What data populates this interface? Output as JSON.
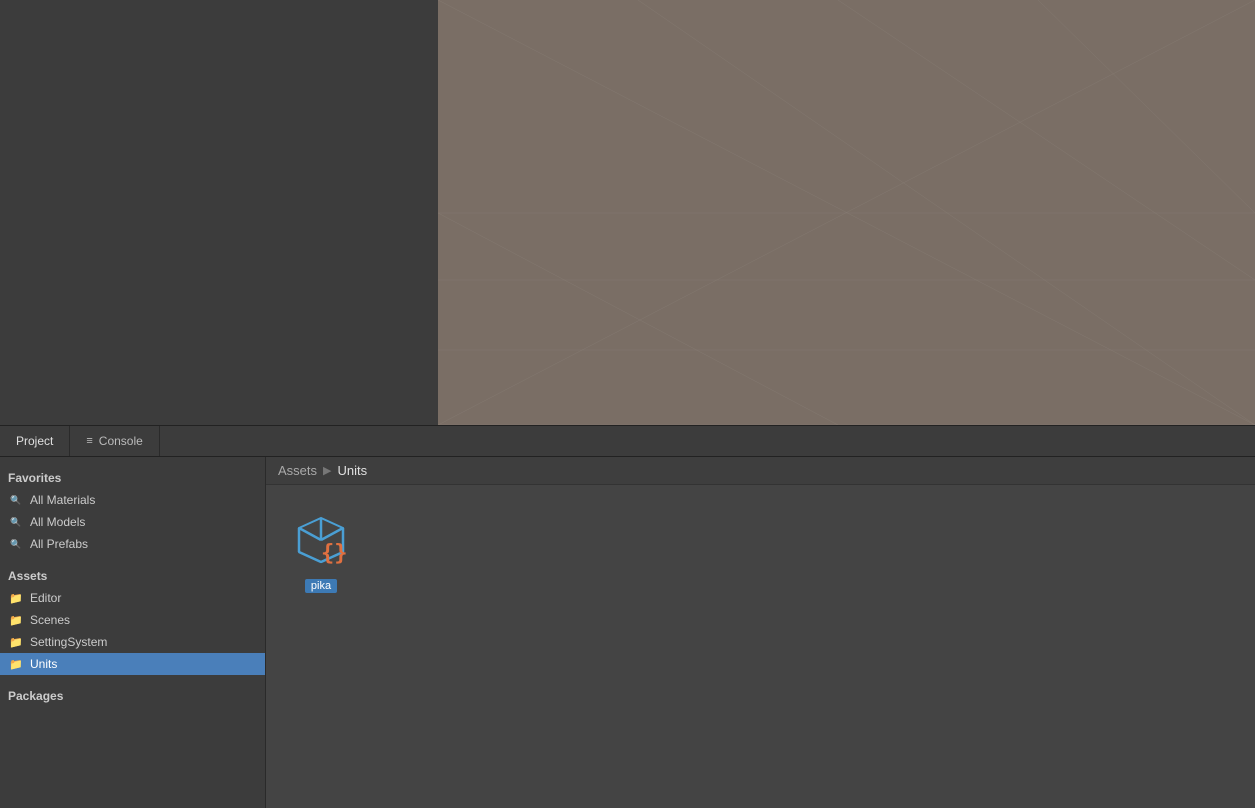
{
  "tabs": [
    {
      "id": "project",
      "label": "Project",
      "icon": "",
      "active": true
    },
    {
      "id": "console",
      "label": "Console",
      "icon": "≡",
      "active": false
    }
  ],
  "sidebar": {
    "favorites_label": "Favorites",
    "favorites_items": [
      {
        "id": "all-materials",
        "label": "All Materials"
      },
      {
        "id": "all-models",
        "label": "All Models"
      },
      {
        "id": "all-prefabs",
        "label": "All Prefabs"
      }
    ],
    "assets_label": "Assets",
    "assets_items": [
      {
        "id": "editor",
        "label": "Editor"
      },
      {
        "id": "scenes",
        "label": "Scenes"
      },
      {
        "id": "setting-system",
        "label": "SettingSystem"
      },
      {
        "id": "units",
        "label": "Units",
        "selected": true
      }
    ],
    "packages_label": "Packages"
  },
  "breadcrumb": {
    "items": [
      {
        "id": "assets",
        "label": "Assets"
      },
      {
        "id": "units",
        "label": "Units"
      }
    ]
  },
  "file_grid": {
    "items": [
      {
        "id": "pika",
        "label": "pika",
        "type": "prefab-script"
      }
    ]
  },
  "colors": {
    "viewport_bg": "#7a6e65",
    "grid_line": "#8a8078",
    "selected_bg": "#4a7fba",
    "file_label_bg": "#3d7ab5",
    "cube_blue": "#4a9fd4",
    "script_orange": "#e07040"
  }
}
